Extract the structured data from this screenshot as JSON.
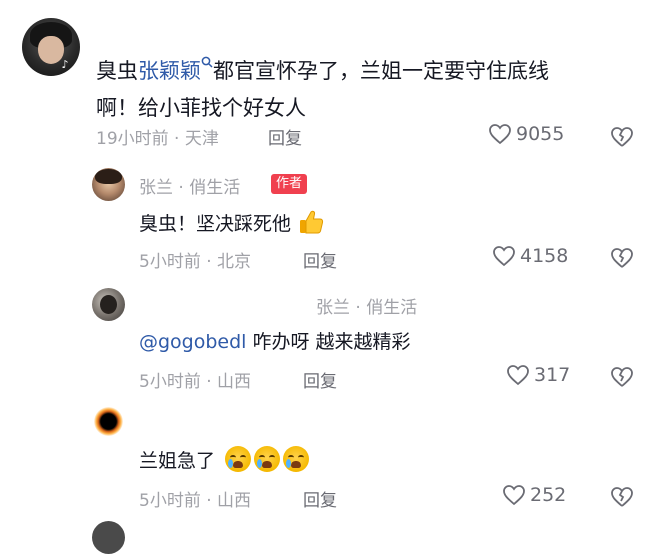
{
  "main_comment": {
    "line1_prefix": "臭虫",
    "mention": "张颖颖",
    "line1_suffix": "都官宣怀孕了，兰姐一定要守住底线",
    "line2": "啊！给小菲找个好女人",
    "meta": "19小时前 · 天津",
    "reply_label": "回复",
    "likes": "9055"
  },
  "replies": [
    {
      "username": "张兰 · 俏生活",
      "badge": "作者",
      "text": "臭虫！坚决踩死他",
      "meta": "5小时前 · 北京",
      "reply_label": "回复",
      "likes": "4158"
    },
    {
      "username": "张兰 · 俏生活",
      "mention": "@gogobedl",
      "text": " 咋办呀 越来越精彩",
      "meta": "5小时前 · 山西",
      "reply_label": "回复",
      "likes": "317"
    },
    {
      "username": "",
      "text": "兰姐急了",
      "meta": "5小时前 · 山西",
      "reply_label": "回复",
      "likes": "252"
    }
  ],
  "icons": {
    "search": "search-icon",
    "heart": "heart-icon",
    "dislike": "broken-heart-icon",
    "thumbs_up": "thumbs-up-emoji",
    "crying": "crying-emoji"
  },
  "colors": {
    "mention": "#2f5aa8",
    "badge": "#f0404f",
    "meta": "#a0a1a7"
  }
}
